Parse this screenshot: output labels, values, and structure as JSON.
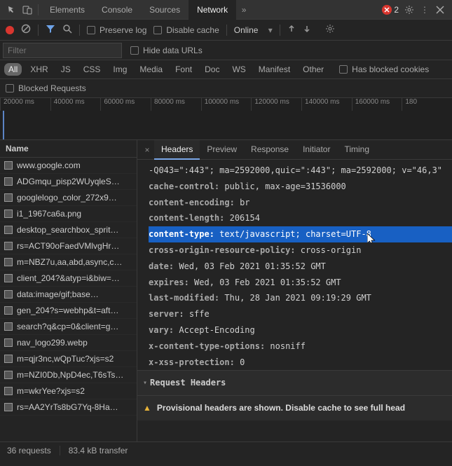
{
  "topTabs": {
    "inspect": "inspect-icon",
    "device": "device-icon",
    "tabs": [
      "Elements",
      "Console",
      "Sources",
      "Network"
    ],
    "activeIndex": 3,
    "more": "»",
    "errorCount": "2"
  },
  "toolbar": {
    "preserveLog": "Preserve log",
    "disableCache": "Disable cache",
    "throttling": "Online"
  },
  "filter": {
    "placeholder": "Filter",
    "hideDataURLs": "Hide data URLs"
  },
  "types": {
    "pills": [
      "All",
      "XHR",
      "JS",
      "CSS",
      "Img",
      "Media",
      "Font",
      "Doc",
      "WS",
      "Manifest",
      "Other"
    ],
    "activeIndex": 0,
    "hasBlockedCookies": "Has blocked cookies"
  },
  "blockedRequests": "Blocked Requests",
  "timeline": {
    "ticks": [
      "20000 ms",
      "40000 ms",
      "60000 ms",
      "80000 ms",
      "100000 ms",
      "120000 ms",
      "140000 ms",
      "160000 ms",
      "180"
    ]
  },
  "requests": {
    "column": "Name",
    "items": [
      "www.google.com",
      "ADGmqu_pisp2WUyqleS…",
      "googlelogo_color_272x9…",
      "i1_1967ca6a.png",
      "desktop_searchbox_sprit…",
      "rs=ACT90oFaedVMlvgHr…",
      "m=NBZ7u,aa,abd,async,c…",
      "client_204?&atyp=i&biw=…",
      "data:image/gif;base…",
      "gen_204?s=webhp&t=aft…",
      "search?q&cp=0&client=g…",
      "nav_logo299.webp",
      "m=qjr3nc,wQpTuc?xjs=s2",
      "m=NZI0Db,NpD4ec,T6sTs…",
      "m=wkrYee?xjs=s2",
      "rs=AA2YrTs8bG7Yq-8Ha…"
    ]
  },
  "detailTabs": {
    "tabs": [
      "Headers",
      "Preview",
      "Response",
      "Initiator",
      "Timing"
    ],
    "activeIndex": 0
  },
  "headerFragment": "-Q043=\":443\"; ma=2592000,quic=\":443\"; ma=2592000; v=\"46,3\"",
  "responseHeaders": [
    {
      "k": "cache-control:",
      "v": "public, max-age=31536000"
    },
    {
      "k": "content-encoding:",
      "v": "br"
    },
    {
      "k": "content-length:",
      "v": "206154"
    },
    {
      "k": "content-type:",
      "v": "text/javascript; charset=UTF-8",
      "selected": true
    },
    {
      "k": "cross-origin-resource-policy:",
      "v": "cross-origin"
    },
    {
      "k": "date:",
      "v": "Wed, 03 Feb 2021 01:35:52 GMT"
    },
    {
      "k": "expires:",
      "v": "Wed, 03 Feb 2021 01:35:52 GMT"
    },
    {
      "k": "last-modified:",
      "v": "Thu, 28 Jan 2021 09:19:29 GMT"
    },
    {
      "k": "server:",
      "v": "sffe"
    },
    {
      "k": "vary:",
      "v": "Accept-Encoding"
    },
    {
      "k": "x-content-type-options:",
      "v": "nosniff"
    },
    {
      "k": "x-xss-protection:",
      "v": "0"
    }
  ],
  "requestHeadersTitle": "Request Headers",
  "provisionalWarning": "Provisional headers are shown. Disable cache to see full head",
  "status": {
    "requests": "36 requests",
    "transfer": "83.4 kB transfer"
  }
}
